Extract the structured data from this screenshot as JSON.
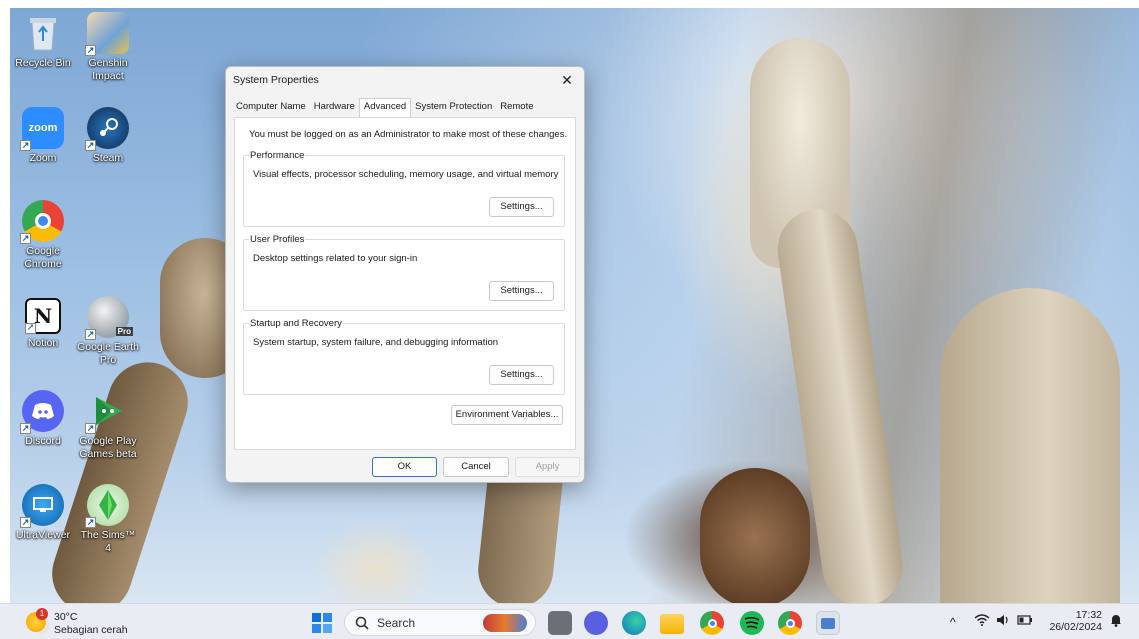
{
  "desktop": {
    "icons": [
      {
        "label": "Recycle Bin"
      },
      {
        "label": "Genshin Impact"
      },
      {
        "label": "Zoom",
        "glyph": "zoom"
      },
      {
        "label": "Steam"
      },
      {
        "label": "Google Chrome"
      },
      {
        "label": "Notion",
        "glyph": "N"
      },
      {
        "label": "Google Earth Pro",
        "badge": "Pro"
      },
      {
        "label": "Discord"
      },
      {
        "label": "Google Play Games beta"
      },
      {
        "label": "UltraViewer"
      },
      {
        "label": "The Sims™ 4"
      }
    ]
  },
  "dialog": {
    "title": "System Properties",
    "close_glyph": "✕",
    "tabs": [
      "Computer Name",
      "Hardware",
      "Advanced",
      "System Protection",
      "Remote"
    ],
    "active_tab": "Advanced",
    "admin_note": "You must be logged on as an Administrator to make most of these changes.",
    "groups": [
      {
        "title": "Performance",
        "description": "Visual effects, processor scheduling, memory usage, and virtual memory",
        "button": "Settings..."
      },
      {
        "title": "User Profiles",
        "description": "Desktop settings related to your sign-in",
        "button": "Settings..."
      },
      {
        "title": "Startup and Recovery",
        "description": "System startup, system failure, and debugging information",
        "button": "Settings..."
      }
    ],
    "env_button": "Environment Variables...",
    "ok": "OK",
    "cancel": "Cancel",
    "apply": "Apply"
  },
  "taskbar": {
    "weather": {
      "temp": "30°C",
      "desc": "Sebagian cerah",
      "badge": "1"
    },
    "search_label": "Search",
    "tray": {
      "time": "17:32",
      "date": "26/02/2024",
      "chevron": "^"
    },
    "apps": [
      "start-icon",
      "file-explorer-widget",
      "task-view-icon",
      "meet-icon",
      "edge-icon",
      "folder-icon",
      "chrome-profile-icon",
      "spotify-icon",
      "chrome-icon",
      "control-panel-icon"
    ]
  },
  "colors": {
    "accent": "#3b6fc4",
    "taskbar": "#e9ecf3",
    "dialog": "#f3f3f3"
  }
}
